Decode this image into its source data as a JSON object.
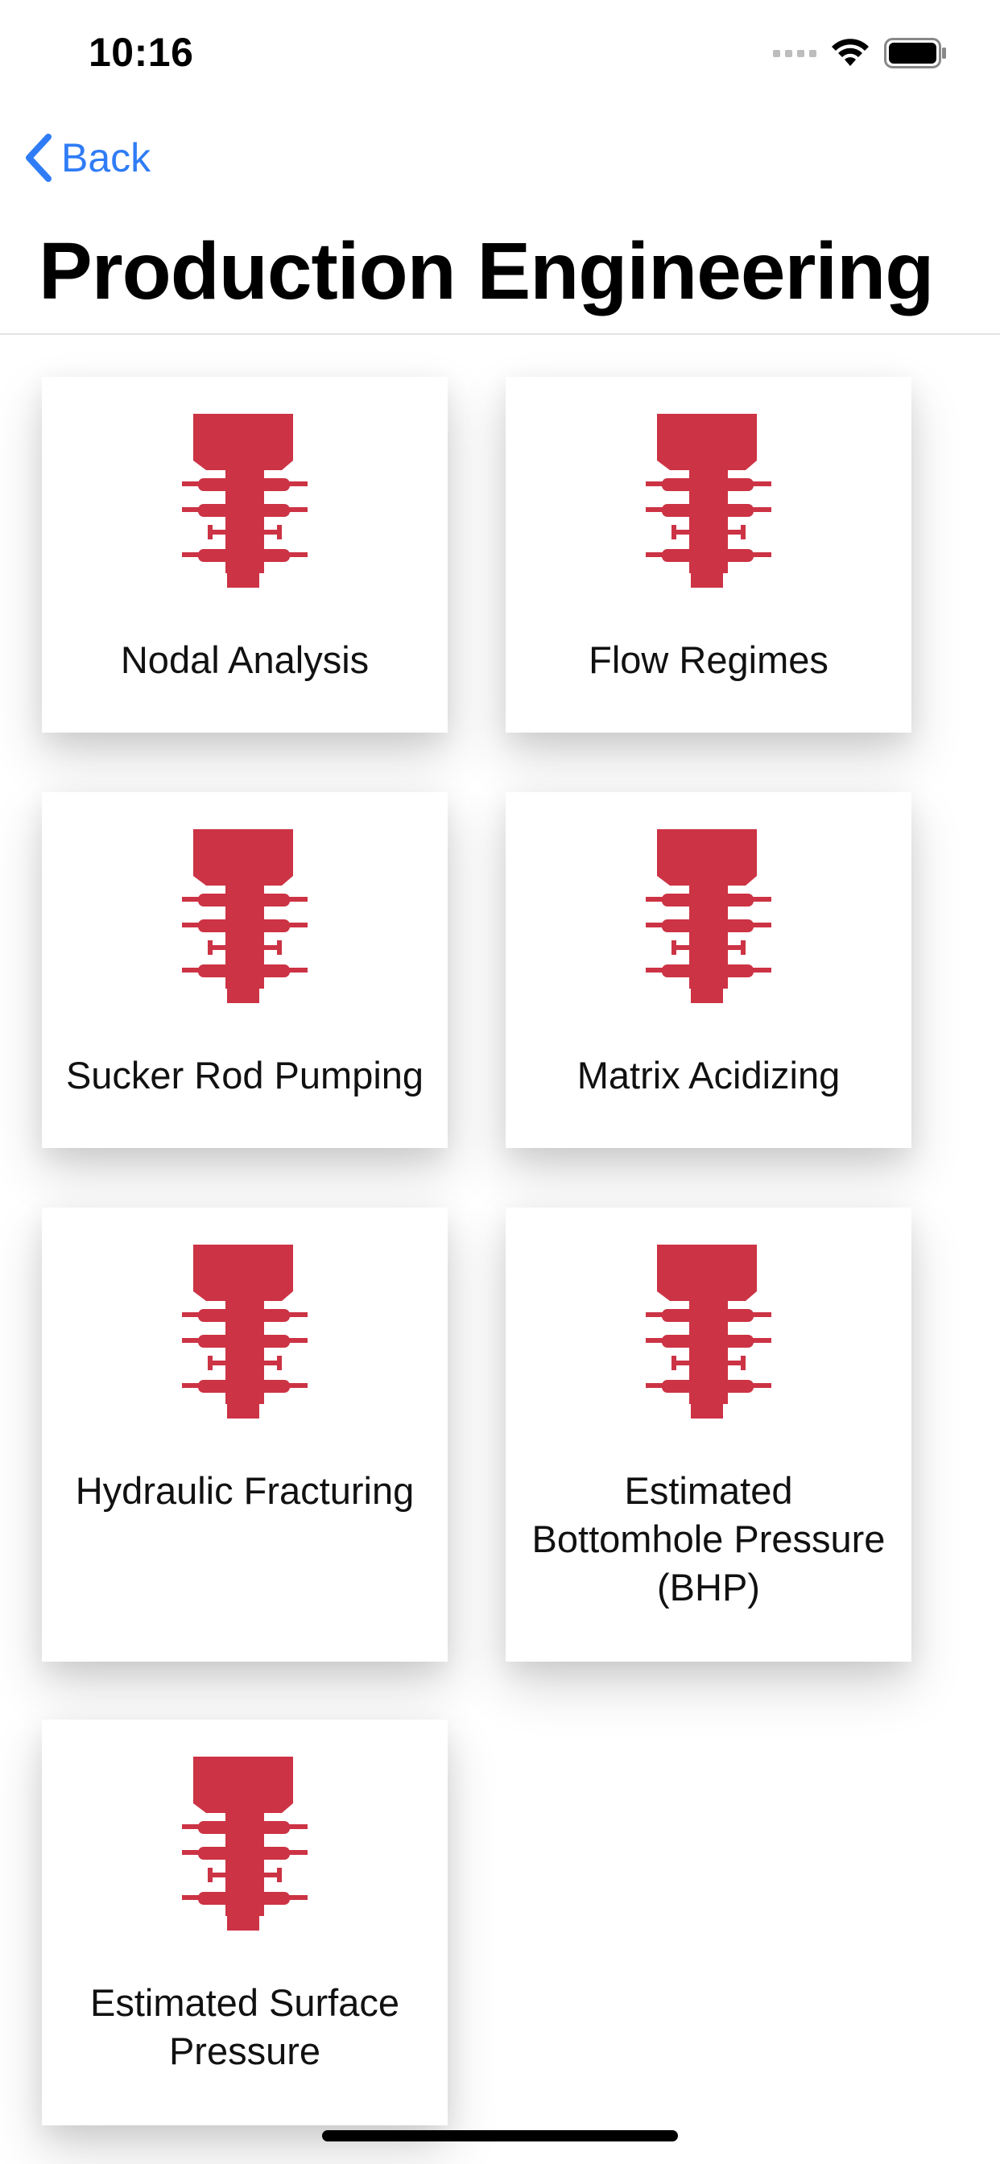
{
  "status_bar": {
    "time": "10:16"
  },
  "nav": {
    "back_label": "Back",
    "title": "Production Engineering"
  },
  "colors": {
    "accent": "#2f7cf6",
    "icon": "#cc3344"
  },
  "cards": [
    {
      "label": "Nodal Analysis",
      "icon": "oil-rig-icon"
    },
    {
      "label": "Flow Regimes",
      "icon": "oil-rig-icon"
    },
    {
      "label": "Sucker Rod Pumping",
      "icon": "oil-rig-icon"
    },
    {
      "label": "Matrix Acidizing",
      "icon": "oil-rig-icon"
    },
    {
      "label": "Hydraulic Fracturing",
      "icon": "oil-rig-icon"
    },
    {
      "label": "Estimated\nBottomhole Pressure\n(BHP)",
      "icon": "oil-rig-icon"
    },
    {
      "label": "Estimated Surface\nPressure",
      "icon": "oil-rig-icon"
    }
  ]
}
